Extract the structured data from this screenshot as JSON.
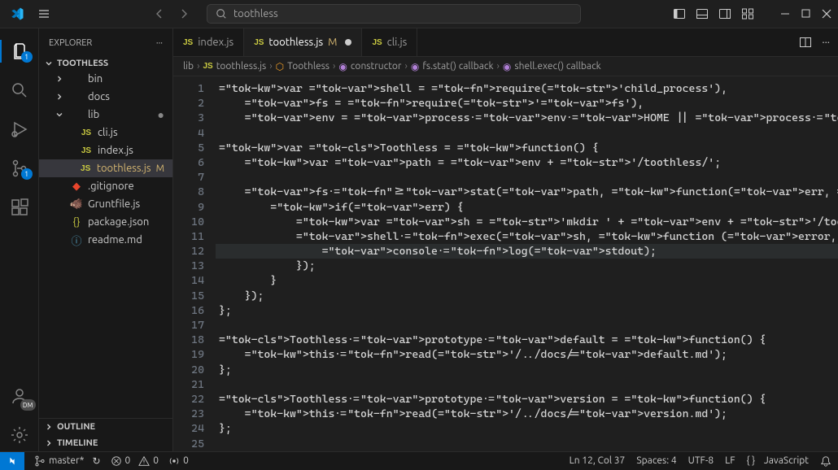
{
  "titlebar": {
    "search_text": "toothless"
  },
  "activitybar": {
    "explorer_badge": "1",
    "scm_badge": "1",
    "account_initials": "DM"
  },
  "sidebar": {
    "title": "EXPLORER",
    "root": "TOOTHLESS",
    "items": [
      {
        "label": "bin",
        "type": "folder",
        "depth": 1,
        "expanded": false
      },
      {
        "label": "docs",
        "type": "folder",
        "depth": 1,
        "expanded": false
      },
      {
        "label": "lib",
        "type": "folder",
        "depth": 1,
        "expanded": true,
        "dirty": true
      },
      {
        "label": "cli.js",
        "type": "js",
        "depth": 2
      },
      {
        "label": "index.js",
        "type": "js",
        "depth": 2
      },
      {
        "label": "toothless.js",
        "type": "js",
        "depth": 2,
        "selected": true,
        "modified": "M"
      },
      {
        "label": ".gitignore",
        "type": "git",
        "depth": 1
      },
      {
        "label": "Gruntfile.js",
        "type": "grunt",
        "depth": 1
      },
      {
        "label": "package.json",
        "type": "json",
        "depth": 1
      },
      {
        "label": "readme.md",
        "type": "info",
        "depth": 1
      }
    ],
    "outline": "OUTLINE",
    "timeline": "TIMELINE"
  },
  "tabs": [
    {
      "label": "index.js",
      "icon": "js",
      "active": false
    },
    {
      "label": "toothless.js",
      "icon": "js",
      "active": true,
      "suffix": "M",
      "dirty": true
    },
    {
      "label": "cli.js",
      "icon": "js",
      "active": false
    }
  ],
  "breadcrumbs": [
    {
      "label": "lib",
      "icon": ""
    },
    {
      "label": "toothless.js",
      "icon": "js"
    },
    {
      "label": "Toothless",
      "icon": "class"
    },
    {
      "label": "constructor",
      "icon": "method"
    },
    {
      "label": "fs.stat() callback",
      "icon": "method"
    },
    {
      "label": "shell.exec() callback",
      "icon": "method"
    }
  ],
  "code": {
    "lines": 25,
    "current_line": 12,
    "content": [
      "var shell = require('child_process'),",
      "    fs = require('fs'),",
      "    env = process.env.HOME || process.env.HOMEPATH || process.env.USERPROFILE;",
      "",
      "var Toothless = function() {",
      "    var path = env + '/toothless/';",
      "",
      "    fs.stat(path, function(err, stat) {",
      "        if(err) {",
      "            var sh = 'mkdir ' + env + '/toothless/';",
      "            shell.exec(sh, function (error, stdout, stderr) {",
      "                console.log(stdout);",
      "            });",
      "        }",
      "    });",
      "};",
      "",
      "Toothless.prototype.default = function() {",
      "    this.read('/../docs/default.md');",
      "};",
      "",
      "Toothless.prototype.version = function() {",
      "    this.read('/../docs/version.md');",
      "};",
      ""
    ]
  },
  "statusbar": {
    "branch": "master*",
    "sync": "↻",
    "errors": "0",
    "warnings": "0",
    "ports": "0",
    "cursor": "Ln 12, Col 37",
    "spaces": "Spaces: 4",
    "encoding": "UTF-8",
    "eol": "LF",
    "lang_icon": "{ }",
    "language": "JavaScript"
  }
}
